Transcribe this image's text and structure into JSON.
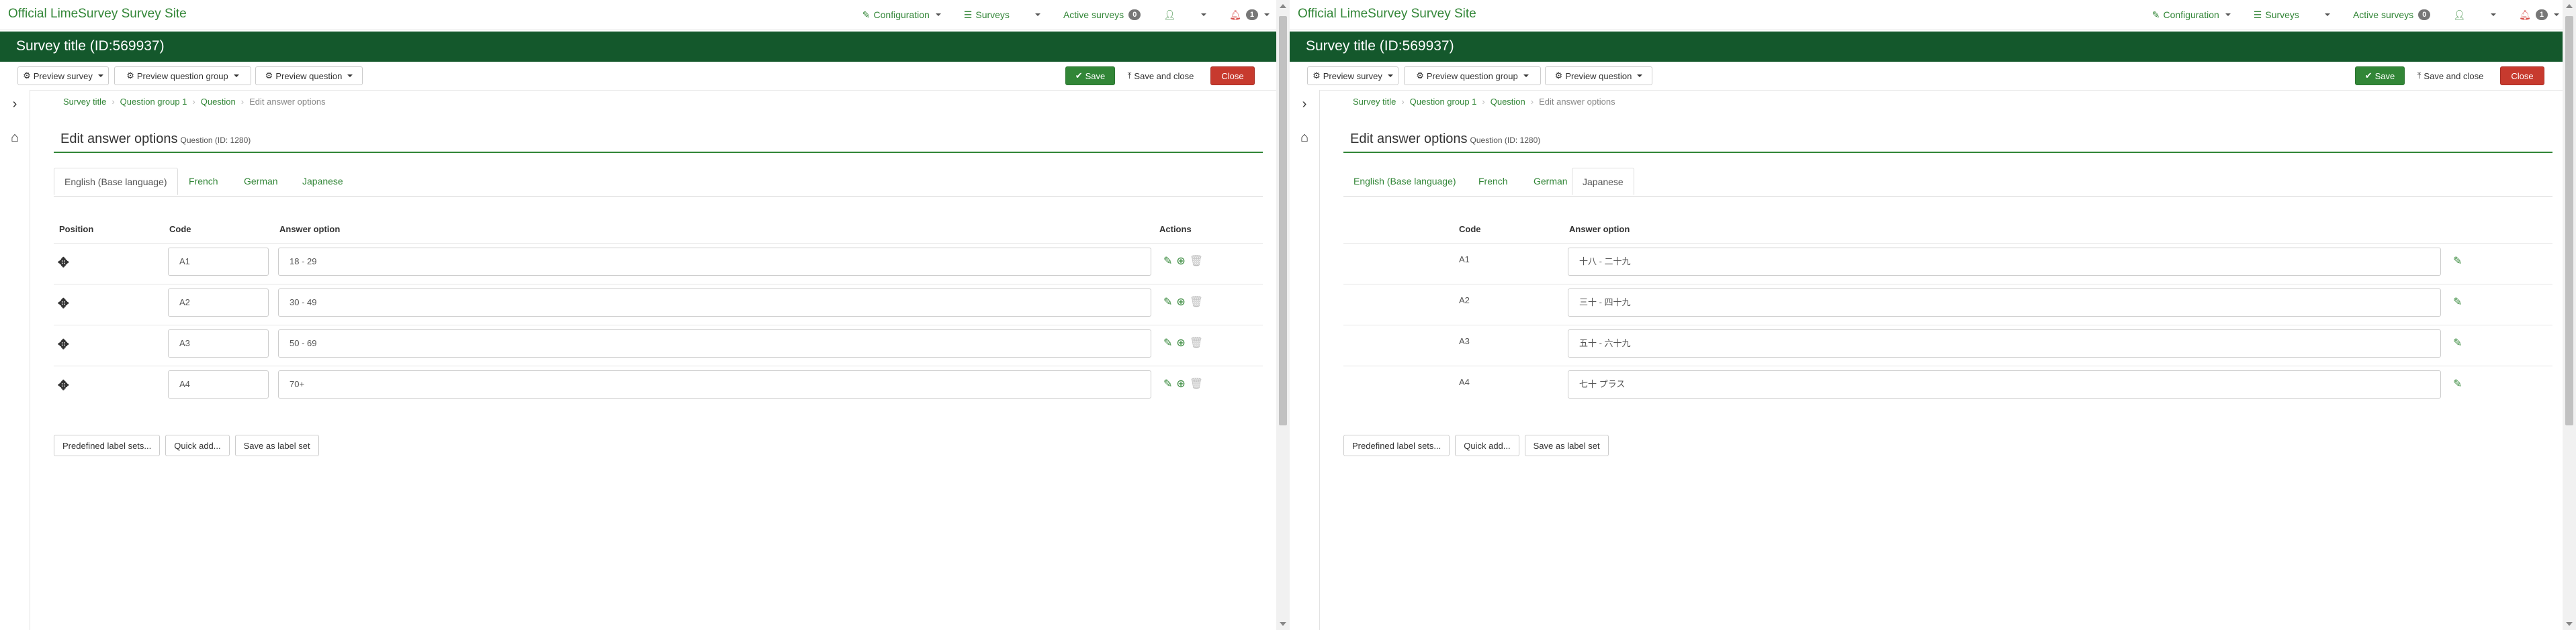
{
  "navbar": {
    "brand": "Official LimeSurvey Survey Site",
    "configuration": "Configuration",
    "surveys": "Surveys",
    "active_surveys": "Active surveys",
    "active_count": "0",
    "notifications_count": "1"
  },
  "titlebar": {
    "title": "Survey title (ID:569937)"
  },
  "toolbar": {
    "preview_survey": "Preview survey",
    "preview_question_group": "Preview question group",
    "preview_question": "Preview question",
    "save": "Save",
    "save_and_close": "Save and close",
    "close": "Close"
  },
  "breadcrumb": {
    "survey": "Survey title",
    "group": "Question group 1",
    "question": "Question",
    "current": "Edit answer options"
  },
  "page_header": {
    "title": "Edit answer options",
    "subtitle": "Question (ID: 1280)"
  },
  "tabs": [
    "English (Base language)",
    "French",
    "German",
    "Japanese"
  ],
  "left_table": {
    "headers": {
      "position": "Position",
      "code": "Code",
      "answer": "Answer option",
      "actions": "Actions"
    },
    "rows": [
      {
        "code": "A1",
        "answer": "18 - 29"
      },
      {
        "code": "A2",
        "answer": "30 - 49"
      },
      {
        "code": "A3",
        "answer": "50 - 69"
      },
      {
        "code": "A4",
        "answer": "70+"
      }
    ]
  },
  "right_table": {
    "headers": {
      "code": "Code",
      "answer": "Answer option"
    },
    "rows": [
      {
        "code": "A1",
        "answer": "十八 - 二十九"
      },
      {
        "code": "A2",
        "answer": "三十 - 四十九"
      },
      {
        "code": "A3",
        "answer": "五十 - 六十九"
      },
      {
        "code": "A4",
        "answer": "七十 プラス"
      }
    ]
  },
  "bottom_buttons": {
    "predefined": "Predefined label sets...",
    "quick_add": "Quick add...",
    "save_label": "Save as label set"
  }
}
